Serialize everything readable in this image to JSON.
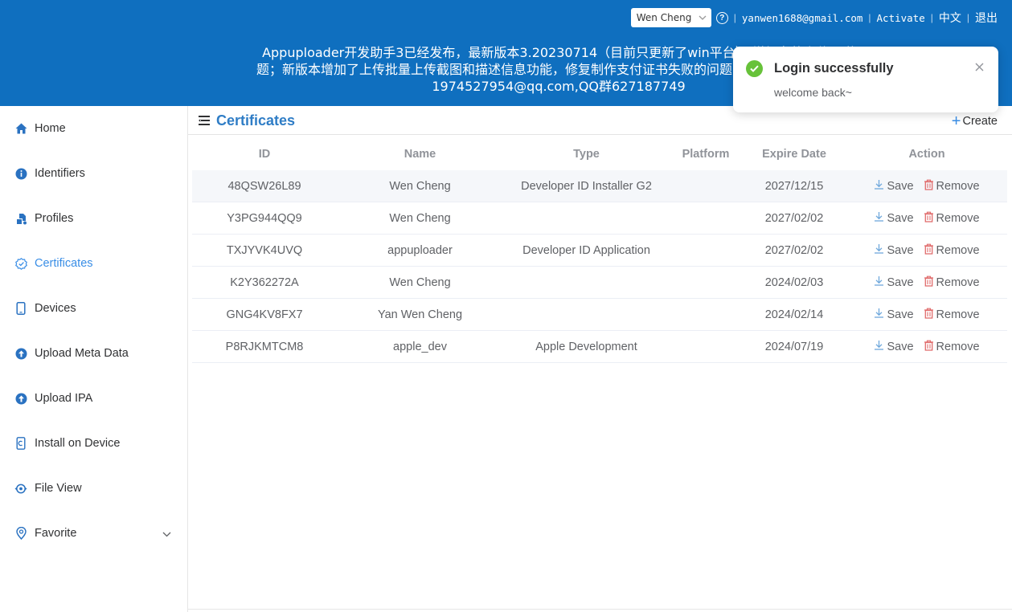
{
  "colors": {
    "header": "#0f6fbf",
    "accent": "#3a8ee6",
    "success": "#67c23a",
    "remove": "#e06c6c"
  },
  "topbar": {
    "team": "Wen Cheng",
    "email": "yanwen1688@gmail.com",
    "activate": "Activate",
    "language": "中文",
    "logout": "退出"
  },
  "notice": {
    "line1": "Appuploader开发助手3已经发布，最新版本3.20230714（目前只更新了win平台）,增加老的上传通道",
    "line2": "题；新版本增加了上传批量上传截图和描述信息功能，修复制作支付证书失败的问题，请老版本用户及时更",
    "line3": "1974527954@qq.com,QQ群627187749"
  },
  "sidebar": {
    "items": [
      {
        "label": "Home",
        "icon": "home-icon"
      },
      {
        "label": "Identifiers",
        "icon": "info-icon"
      },
      {
        "label": "Profiles",
        "icon": "profiles-icon"
      },
      {
        "label": "Certificates",
        "icon": "certificate-icon"
      },
      {
        "label": "Devices",
        "icon": "phone-icon"
      },
      {
        "label": "Upload Meta Data",
        "icon": "upload-icon"
      },
      {
        "label": "Upload IPA",
        "icon": "upload-icon"
      },
      {
        "label": "Install on Device",
        "icon": "install-icon"
      },
      {
        "label": "File View",
        "icon": "file-view-icon"
      },
      {
        "label": "Favorite",
        "icon": "location-icon"
      }
    ]
  },
  "main": {
    "title": "Certificates",
    "create": "Create",
    "columns": {
      "id": "ID",
      "name": "Name",
      "type": "Type",
      "platform": "Platform",
      "expire": "Expire Date",
      "action": "Action"
    },
    "save_label": "Save",
    "remove_label": "Remove",
    "rows": [
      {
        "id": "48QSW26L89",
        "name": "Wen Cheng",
        "type": "Developer ID Installer G2",
        "platform": "",
        "expire": "2027/12/15"
      },
      {
        "id": "Y3PG944QQ9",
        "name": "Wen Cheng",
        "type": "",
        "platform": "",
        "expire": "2027/02/02"
      },
      {
        "id": "TXJYVK4UVQ",
        "name": "appuploader",
        "type": "Developer ID Application",
        "platform": "",
        "expire": "2027/02/02"
      },
      {
        "id": "K2Y362272A",
        "name": "Wen Cheng",
        "type": "",
        "platform": "",
        "expire": "2024/02/03"
      },
      {
        "id": "GNG4KV8FX7",
        "name": "Yan Wen Cheng",
        "type": "",
        "platform": "",
        "expire": "2024/02/14"
      },
      {
        "id": "P8RJKMTCM8",
        "name": "apple_dev",
        "type": "Apple Development",
        "platform": "",
        "expire": "2024/07/19"
      }
    ]
  },
  "toast": {
    "title": "Login successfully",
    "message": "welcome back~"
  }
}
